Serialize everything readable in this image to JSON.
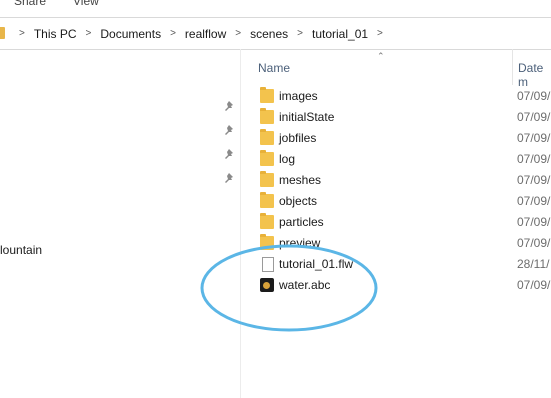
{
  "ribbon": {
    "tabs": [
      "Share",
      "View"
    ]
  },
  "address_bar": {
    "crumbs": [
      "This PC",
      "Documents",
      "realflow",
      "scenes",
      "tutorial_01"
    ]
  },
  "nav_pane": {
    "visible_item": "lountain"
  },
  "file_list": {
    "columns": {
      "name": "Name",
      "date": "Date m"
    },
    "rows": [
      {
        "name": "images",
        "type": "folder",
        "date": "07/09/"
      },
      {
        "name": "initialState",
        "type": "folder",
        "date": "07/09/"
      },
      {
        "name": "jobfiles",
        "type": "folder",
        "date": "07/09/"
      },
      {
        "name": "log",
        "type": "folder",
        "date": "07/09/"
      },
      {
        "name": "meshes",
        "type": "folder",
        "date": "07/09/"
      },
      {
        "name": "objects",
        "type": "folder",
        "date": "07/09/"
      },
      {
        "name": "particles",
        "type": "folder",
        "date": "07/09/"
      },
      {
        "name": "preview",
        "type": "folder",
        "date": "07/09/"
      },
      {
        "name": "tutorial_01.flw",
        "type": "file",
        "date": "28/11/"
      },
      {
        "name": "water.abc",
        "type": "abc",
        "date": "07/09/"
      }
    ]
  },
  "annotation": {
    "color": "#5bb6e6"
  }
}
